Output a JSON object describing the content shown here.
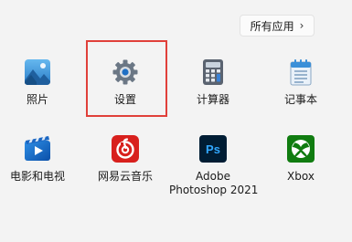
{
  "header": {
    "all_apps_label": "所有应用",
    "chevron": "›"
  },
  "apps": [
    {
      "label": "照片",
      "icon": "photos-icon"
    },
    {
      "label": "设置",
      "icon": "gear-icon",
      "highlighted": true
    },
    {
      "label": "计算器",
      "icon": "calculator-icon"
    },
    {
      "label": "记事本",
      "icon": "notepad-icon"
    },
    {
      "label": "电影和电视",
      "icon": "movies-tv-icon"
    },
    {
      "label": "网易云音乐",
      "icon": "netease-music-icon"
    },
    {
      "label_line1": "Adobe",
      "label_line2": "Photoshop 2021",
      "icon": "photoshop-icon"
    },
    {
      "label": "Xbox",
      "icon": "xbox-icon"
    }
  ],
  "colors": {
    "background": "#f3f3f3",
    "highlight_border": "#e0403a"
  }
}
